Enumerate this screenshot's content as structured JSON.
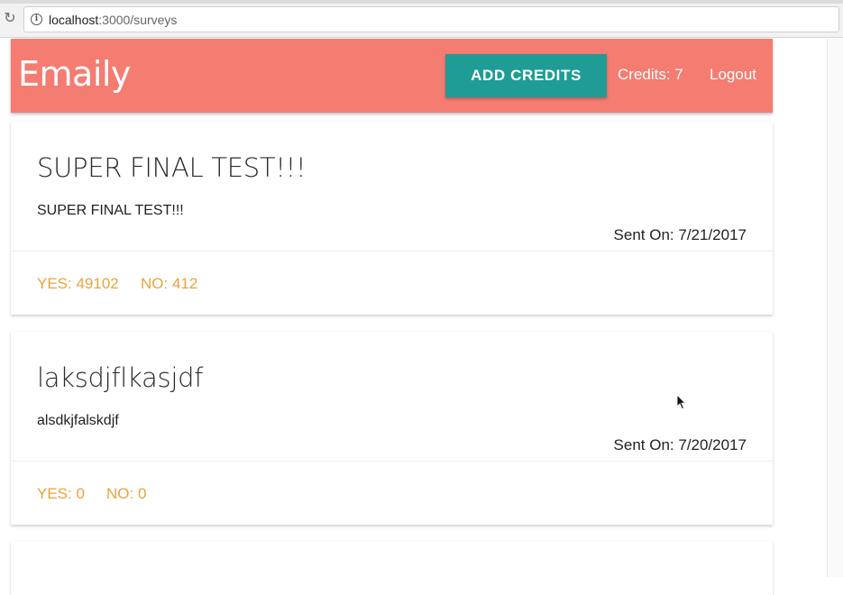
{
  "browser": {
    "url_host": "localhost",
    "url_path": ":3000/surveys"
  },
  "navbar": {
    "brand": "Emaily",
    "add_credits_label": "ADD CREDITS",
    "credits_label": "Credits: 7",
    "logout_label": "Logout"
  },
  "surveys": [
    {
      "title": "SUPER FINAL TEST!!!",
      "body": "SUPER FINAL TEST!!!",
      "sent_on": "Sent On: 7/21/2017",
      "yes": "YES: 49102",
      "no": "NO: 412"
    },
    {
      "title": "laksdjflkasjdf",
      "body": "alsdkjfalskdjf",
      "sent_on": "Sent On: 7/20/2017",
      "yes": "YES: 0",
      "no": "NO: 0"
    }
  ],
  "colors": {
    "navbar": "#f47c71",
    "button": "#1f9c96",
    "vote_text": "#eaa43a"
  }
}
